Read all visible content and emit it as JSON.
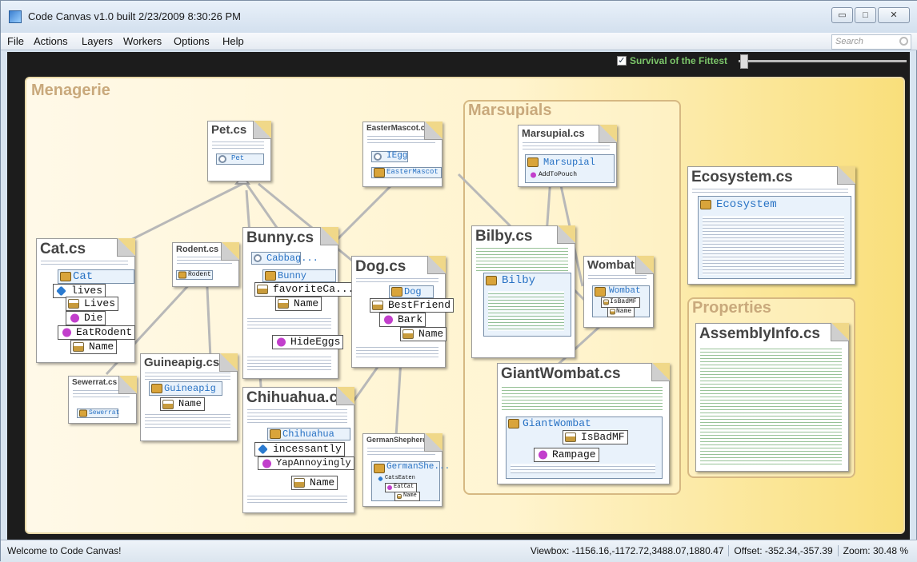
{
  "window": {
    "title": "Code Canvas v1.0 built 2/23/2009 8:30:26 PM",
    "min": "▭",
    "max": "□",
    "close": "✕"
  },
  "menu": [
    "File",
    "Actions",
    "Layers",
    "Workers",
    "Options",
    "Help"
  ],
  "search": {
    "placeholder": "Search"
  },
  "toolbar": {
    "survival_label": "Survival of the Fittest",
    "survival_checked": "✓"
  },
  "groups": {
    "menagerie": "Menagerie",
    "marsupials": "Marsupials",
    "properties": "Properties"
  },
  "files": {
    "pet": "Pet.cs",
    "easter": "EasterMascot.cs",
    "marsupial": "Marsupial.cs",
    "ecosystem": "Ecosystem.cs",
    "cat": "Cat.cs",
    "rodent": "Rodent.cs",
    "bunny": "Bunny.cs",
    "dog": "Dog.cs",
    "bilby": "Bilby.cs",
    "wombat": "Wombat.cs",
    "guineapig": "Guineapig.cs",
    "sewerrat": "Sewerrat.cs",
    "chihuahua": "Chihuahua.cs",
    "german": "GermanShepherd.cs",
    "giantwombat": "GiantWombat.cs",
    "assembly": "AssemblyInfo.cs"
  },
  "types": {
    "pet": "Pet",
    "iegg": "IEgg",
    "easter": "EasterMascot",
    "marsupial": "Marsupial",
    "ecosystem": "Ecosystem",
    "cat": "Cat",
    "rodent": "Rodent",
    "cabbage": "Cabbag...",
    "bunny": "Bunny",
    "dog": "Dog",
    "bilby": "Bilby",
    "wombat": "Wombat",
    "guineapig": "Guineapig",
    "sewerrat": "Sewerrat",
    "chihuahua": "Chihuahua",
    "german": "GermanShe...",
    "giantwombat": "GiantWombat"
  },
  "members": {
    "cat": [
      "lives",
      "Lives",
      "Die",
      "EatRodent",
      "Name"
    ],
    "bunny": [
      "favoriteCa...",
      "Name",
      "HideEggs"
    ],
    "dog": [
      "BestFriend",
      "Bark",
      "Name"
    ],
    "guineapig": [
      "Name"
    ],
    "chihuahua": [
      "incessantly",
      "YapAnnoyingly",
      "Name"
    ],
    "giantwombat": [
      "IsBadMF",
      "Rampage"
    ],
    "wombat": [
      "IsBadMF",
      "Name"
    ],
    "marsupial": [
      "AddToPouch"
    ],
    "german": [
      "CatsEaten",
      "EatCat",
      "Name"
    ]
  },
  "status": {
    "welcome": "Welcome to Code Canvas!",
    "viewbox": "Viewbox: -1156.16,-1172.72,3488.07,1880.47",
    "offset": "Offset: -352.34,-357.39",
    "zoom": "Zoom: 30.48 %"
  }
}
